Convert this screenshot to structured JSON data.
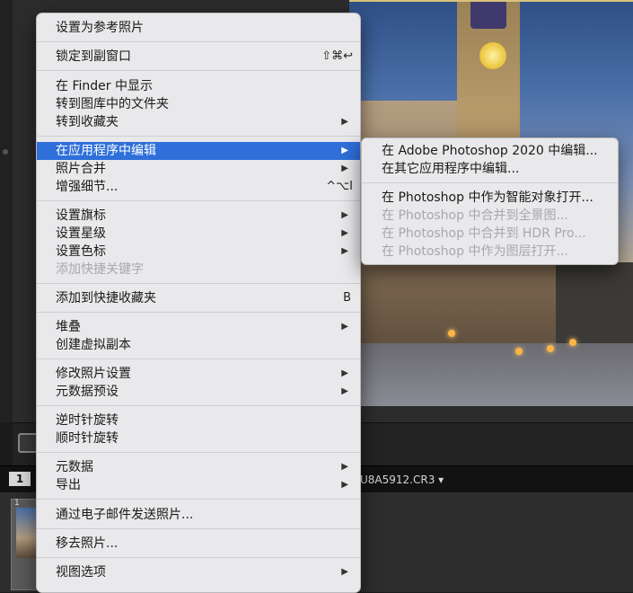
{
  "context_menu": {
    "items": [
      {
        "label": "设置为参考照片"
      },
      {
        "label": "锁定到副窗口",
        "shortcut": "⇧⌘↩"
      },
      {
        "label": "在 Finder 中显示"
      },
      {
        "label": "转到图库中的文件夹"
      },
      {
        "label": "转到收藏夹",
        "arrow": "▶"
      },
      {
        "label": "在应用程序中编辑",
        "arrow": "▶"
      },
      {
        "label": "照片合并",
        "arrow": "▶"
      },
      {
        "label": "增强细节...",
        "shortcut": "^⌥I"
      },
      {
        "label": "设置旗标",
        "arrow": "▶"
      },
      {
        "label": "设置星级",
        "arrow": "▶"
      },
      {
        "label": "设置色标",
        "arrow": "▶"
      },
      {
        "label": "添加快捷关键字"
      },
      {
        "label": "添加到快捷收藏夹",
        "shortcut": "B"
      },
      {
        "label": "堆叠",
        "arrow": "▶"
      },
      {
        "label": "创建虚拟副本"
      },
      {
        "label": "修改照片设置",
        "arrow": "▶"
      },
      {
        "label": "元数据预设",
        "arrow": "▶"
      },
      {
        "label": "逆时针旋转"
      },
      {
        "label": "顺时针旋转"
      },
      {
        "label": "元数据",
        "arrow": "▶"
      },
      {
        "label": "导出",
        "arrow": "▶"
      },
      {
        "label": "通过电子邮件发送照片..."
      },
      {
        "label": "移去照片..."
      },
      {
        "label": "视图选项",
        "arrow": "▶"
      }
    ],
    "active_item": "在应用程序中编辑",
    "disabled_items": [
      "添加快捷关键字"
    ]
  },
  "submenu": {
    "items": [
      {
        "label": "在 Adobe Photoshop 2020 中编辑..."
      },
      {
        "label": "在其它应用程序中编辑..."
      },
      {
        "label": "在 Photoshop 中作为智能对象打开..."
      },
      {
        "label": "在 Photoshop 中合并到全景图..."
      },
      {
        "label": "在 Photoshop 中合并到 HDR Pro..."
      },
      {
        "label": "在 Photoshop 中作为图层打开..."
      }
    ],
    "disabled_items": [
      "在 Photoshop 中合并到全景图...",
      "在 Photoshop 中合并到 HDR Pro...",
      "在 Photoshop 中作为图层打开..."
    ]
  },
  "filmstrip": {
    "page_number": "1",
    "filename": "U8A5912.CR3 ▾",
    "thumb_index": "1"
  },
  "colors": {
    "menu_bg": "#e9e8ea",
    "highlight": "#2f6fd9",
    "disabled_text": "#a8a7aa"
  }
}
